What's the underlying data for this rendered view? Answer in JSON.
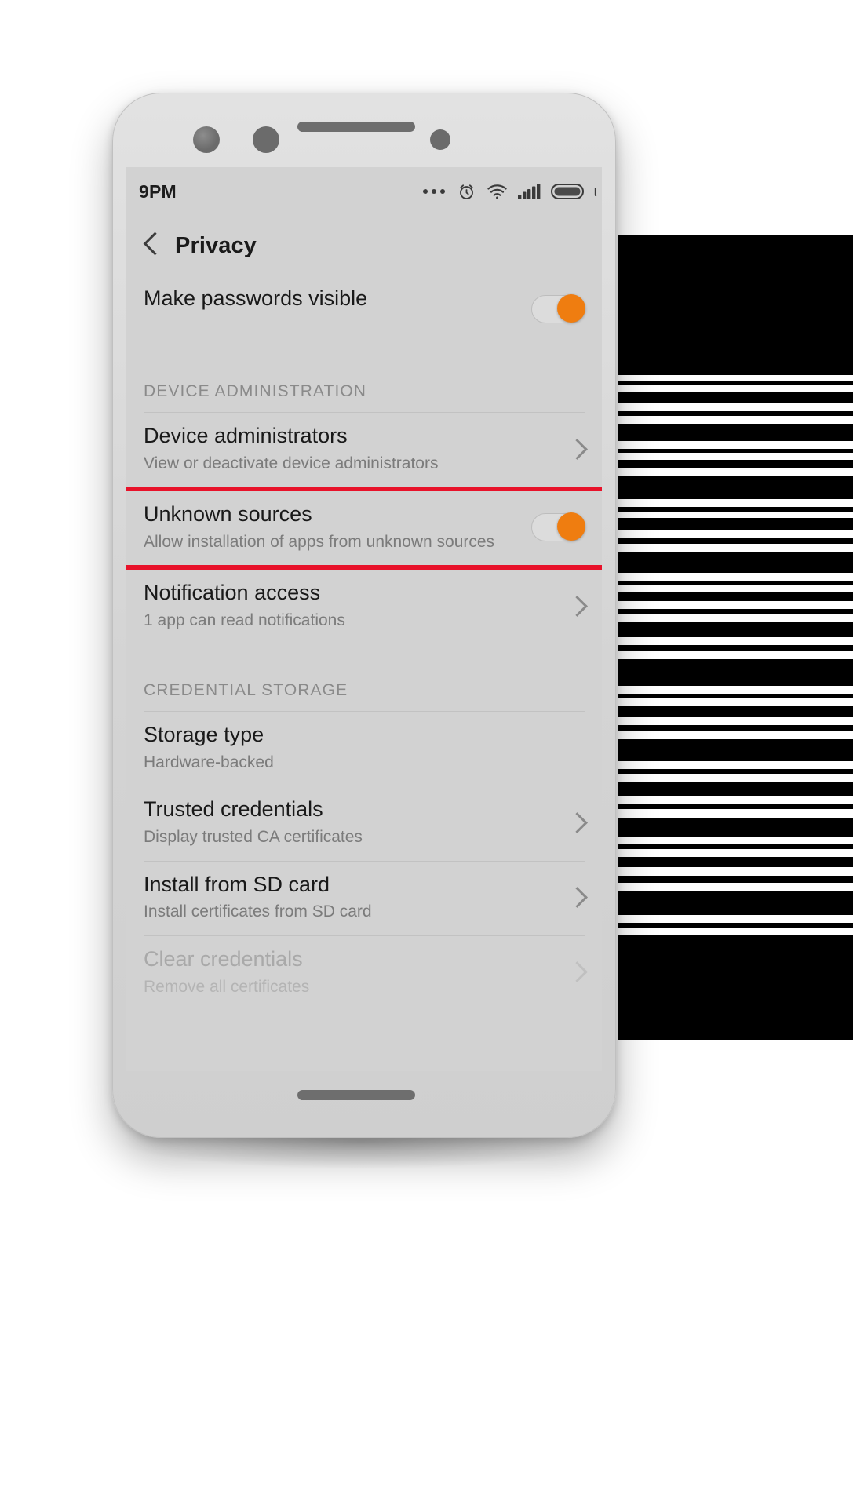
{
  "status_bar": {
    "time": "9PM",
    "icons": [
      "more-dots-icon",
      "alarm-icon",
      "wifi-icon",
      "signal-icon",
      "battery-icon"
    ],
    "battery_tail": "ι"
  },
  "app_bar": {
    "back_icon": "back-chevron-icon",
    "title": "Privacy"
  },
  "colors": {
    "accent": "#ef7d10",
    "highlight": "#e8122a",
    "screen_bg": "#d2d2d2",
    "device_bg": "#d9d9d9",
    "title_text": "#191919",
    "summary_text": "#7b7b7b",
    "disabled_text": "#a9a9a9"
  },
  "list": [
    {
      "type": "row",
      "name": "make-passwords-visible",
      "title": "Make passwords visible",
      "summary": "",
      "control": "toggle",
      "toggle_on": true,
      "highlighted": false,
      "disabled": false
    },
    {
      "type": "section",
      "name": "device-administration",
      "title": "DEVICE ADMINISTRATION"
    },
    {
      "type": "row",
      "name": "device-administrators",
      "title": "Device administrators",
      "summary": "View or deactivate device administrators",
      "control": "chevron",
      "toggle_on": false,
      "highlighted": true,
      "disabled": false
    },
    {
      "type": "row",
      "name": "unknown-sources",
      "title": "Unknown sources",
      "summary": "Allow installation of apps from unknown sources",
      "control": "toggle",
      "toggle_on": true,
      "highlighted": true,
      "disabled": false
    },
    {
      "type": "row",
      "name": "notification-access",
      "title": "Notification access",
      "summary": "1 app can read notifications",
      "control": "chevron",
      "toggle_on": false,
      "highlighted": false,
      "disabled": false
    },
    {
      "type": "section",
      "name": "credential-storage",
      "title": "CREDENTIAL STORAGE"
    },
    {
      "type": "row",
      "name": "storage-type",
      "title": "Storage type",
      "summary": "Hardware-backed",
      "control": "none",
      "toggle_on": false,
      "highlighted": false,
      "disabled": false
    },
    {
      "type": "row",
      "name": "trusted-credentials",
      "title": "Trusted credentials",
      "summary": "Display trusted CA certificates",
      "control": "chevron",
      "toggle_on": false,
      "highlighted": false,
      "disabled": false
    },
    {
      "type": "row",
      "name": "install-from-sd-card",
      "title": "Install from SD card",
      "summary": "Install certificates from SD card",
      "control": "chevron",
      "toggle_on": false,
      "highlighted": false,
      "disabled": false
    },
    {
      "type": "row",
      "name": "clear-credentials",
      "title": "Clear credentials",
      "summary": "Remove all certificates",
      "control": "chevron",
      "toggle_on": false,
      "highlighted": false,
      "disabled": true
    }
  ]
}
